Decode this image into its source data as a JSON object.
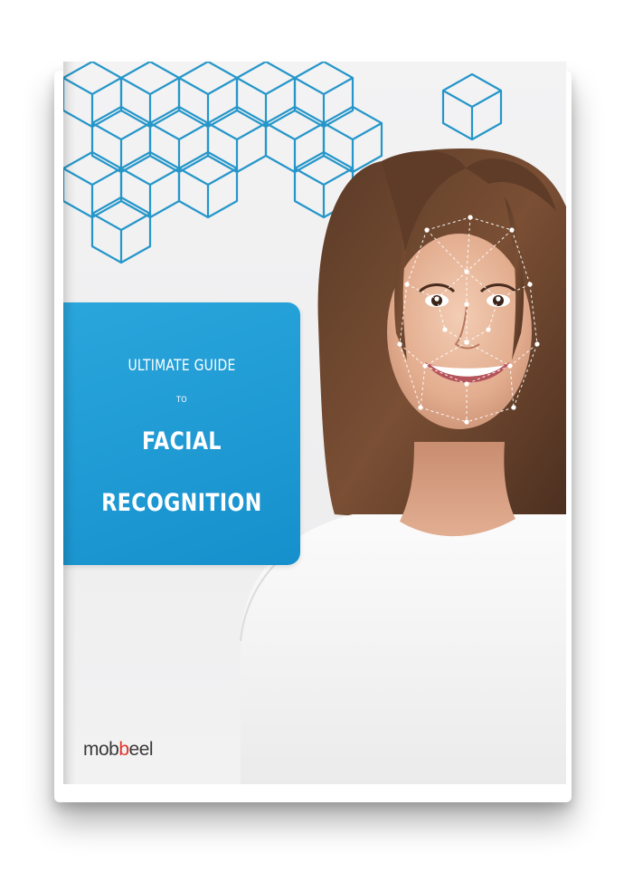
{
  "cover": {
    "subtitle": "ULTIMATE GUIDE",
    "connector": "TO",
    "title_line1": "FACIAL",
    "title_line2": "RECOGNITION",
    "brand_prefix": "mob",
    "brand_accent": "b",
    "brand_suffix": "eel"
  },
  "colors": {
    "accent_blue": "#1a96d2",
    "cube_line": "#2596c9",
    "brand_red": "#e2332b",
    "brand_dark": "#3a3a3a",
    "page_background": "#f2f2f3"
  },
  "images": {
    "portrait": "smiling-woman-with-face-mesh",
    "pattern": "isometric-cube-outline-pattern"
  }
}
